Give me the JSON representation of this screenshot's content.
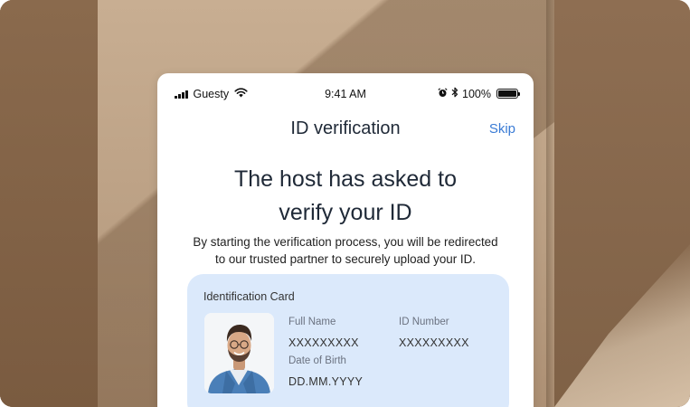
{
  "status_bar": {
    "carrier": "Guesty",
    "time": "9:41 AM",
    "battery": "100%"
  },
  "nav": {
    "title": "ID verification",
    "skip_label": "Skip"
  },
  "main": {
    "headline_line1": "The host has asked to",
    "headline_line2": "verify your ID",
    "description_line1": "By starting the verification process, you will be redirected",
    "description_line2": "to our trusted partner to securely upload your ID."
  },
  "id_card": {
    "title": "Identification Card",
    "full_name_label": "Full Name",
    "full_name_value": "XXXXXXXXX",
    "id_number_label": "ID Number",
    "id_number_value": "XXXXXXXXX",
    "dob_label": "Date of Birth",
    "dob_value": "DD.MM.YYYY"
  },
  "colors": {
    "accent": "#3a7bd5",
    "card_background": "#dbe9fb",
    "panel_background": "#ffffff"
  },
  "icons": [
    "signal-icon",
    "wifi-icon",
    "alarm-icon",
    "bluetooth-icon",
    "battery-icon",
    "id-photo"
  ]
}
